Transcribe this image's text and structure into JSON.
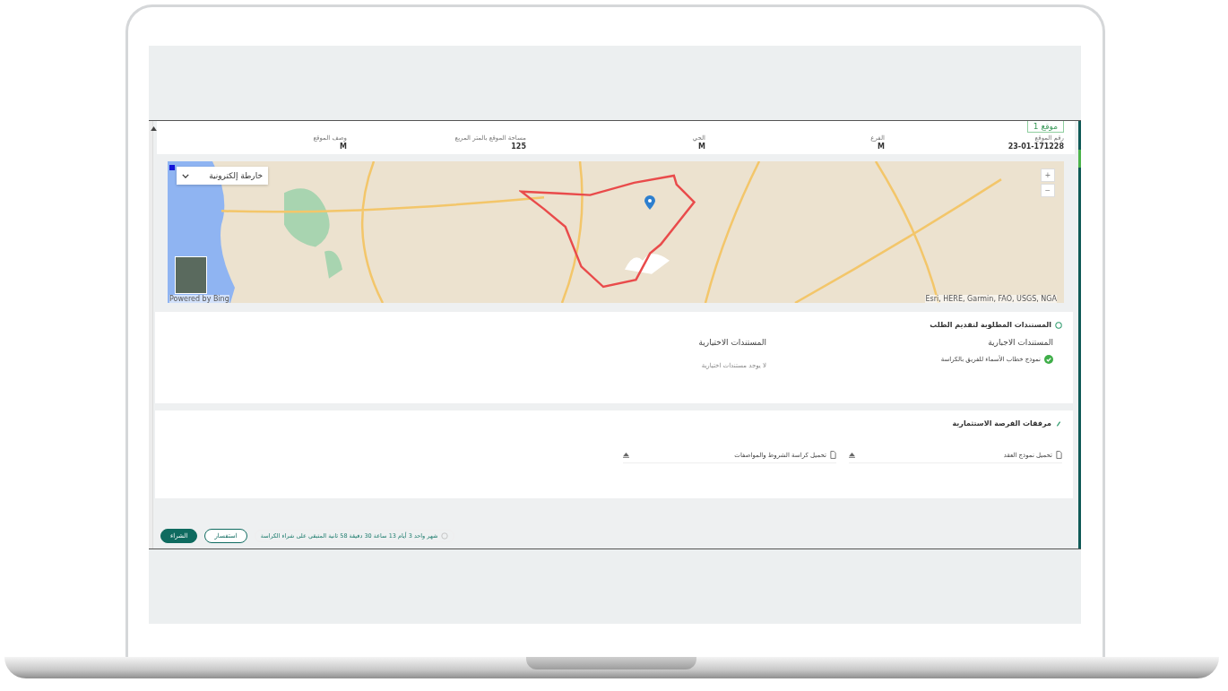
{
  "badge": "موقع 1",
  "site_info": [
    {
      "label": "رقم الموقع",
      "value": "23-01-171228"
    },
    {
      "label": "الفرع",
      "value": "M"
    },
    {
      "label": "الحي",
      "value": "M"
    },
    {
      "label": "مساحة الموقع بالمتر المربع",
      "value": "125"
    },
    {
      "label": "وصف الموقع",
      "value": "M"
    }
  ],
  "map": {
    "layer_select": "خارطة إلكترونية",
    "zoom_in": "+",
    "zoom_out": "−",
    "attribution_left": "Powered by Bing",
    "attribution_right": "Esri, HERE, Garmin, FAO, USGS, NGA"
  },
  "documents": {
    "title": "المستندات المطلوبة لتقديم الطلب",
    "required": {
      "title": "المستندات الاجبارية",
      "items": [
        {
          "label": "نموذج خطاب الأسماء للفريق بالكراسة",
          "uploaded": true
        }
      ]
    },
    "optional": {
      "title": "المستندات الاختيارية",
      "empty": "لا يوجد مستندات اختيارية"
    }
  },
  "attachments": {
    "title": "مرفقات الفرصة الاستثمارية",
    "files": [
      {
        "label": "تحميل نموذج العقد"
      },
      {
        "label": "تحميل كراسة الشروط والمواصفات"
      }
    ]
  },
  "footer": {
    "countdown": "شهر واحد 3 أيام 13 ساعة 30 دقيقة 58 ثانية المتبقي على شراء الكراسة",
    "buttons": [
      {
        "label": "استفسار",
        "kind": "secondary"
      },
      {
        "label": "الشراء",
        "kind": "primary"
      }
    ]
  }
}
